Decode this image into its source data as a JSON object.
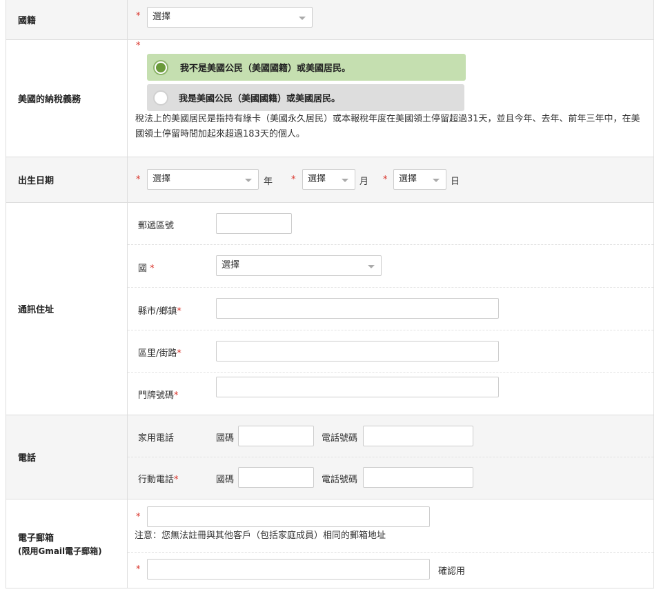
{
  "nationality": {
    "label": "國籍",
    "select": "選擇"
  },
  "us_tax": {
    "label": "美國的納稅義務",
    "options": [
      {
        "text": "我不是美國公民（美國國籍）或美國居民。",
        "selected": true
      },
      {
        "text": "我是美國公民（美國國籍）或美國居民。",
        "selected": false
      }
    ],
    "note": "稅法上的美國居民是指持有綠卡（美國永久居民）或本報稅年度在美國領土停留超過31天，並且今年、去年、前年三年中，在美國領土停留時間加起來超過183天的個人。"
  },
  "birth": {
    "label": "出生日期",
    "year_select": "選擇",
    "year_unit": "年",
    "month_select": "選擇",
    "month_unit": "月",
    "day_select": "選擇",
    "day_unit": "日"
  },
  "address": {
    "label": "通訊住址",
    "postal_label": "郵遞區號",
    "country_label": "國",
    "country_select": "選擇",
    "city_label": "縣市/鄉鎮",
    "street_label": "區里/街路",
    "house_label": "門牌號碼"
  },
  "phone": {
    "label": "電話",
    "home_label": "家用電話",
    "mobile_label": "行動電話",
    "country_code_label": "國碼",
    "number_label": "電話號碼"
  },
  "email": {
    "label": "電子郵箱",
    "sublabel": "(限用Gmail電子郵箱)",
    "note": "注意：您無法註冊與其他客戶（包括家庭成員）相同的郵箱地址",
    "confirm_label": "確認用"
  },
  "required_mark": "*",
  "colors": {
    "required": "#d9342b",
    "selected_option_bg": "#c5dfb0",
    "unselected_option_bg": "#dddddd",
    "radio_dot": "#6a9a3a"
  }
}
